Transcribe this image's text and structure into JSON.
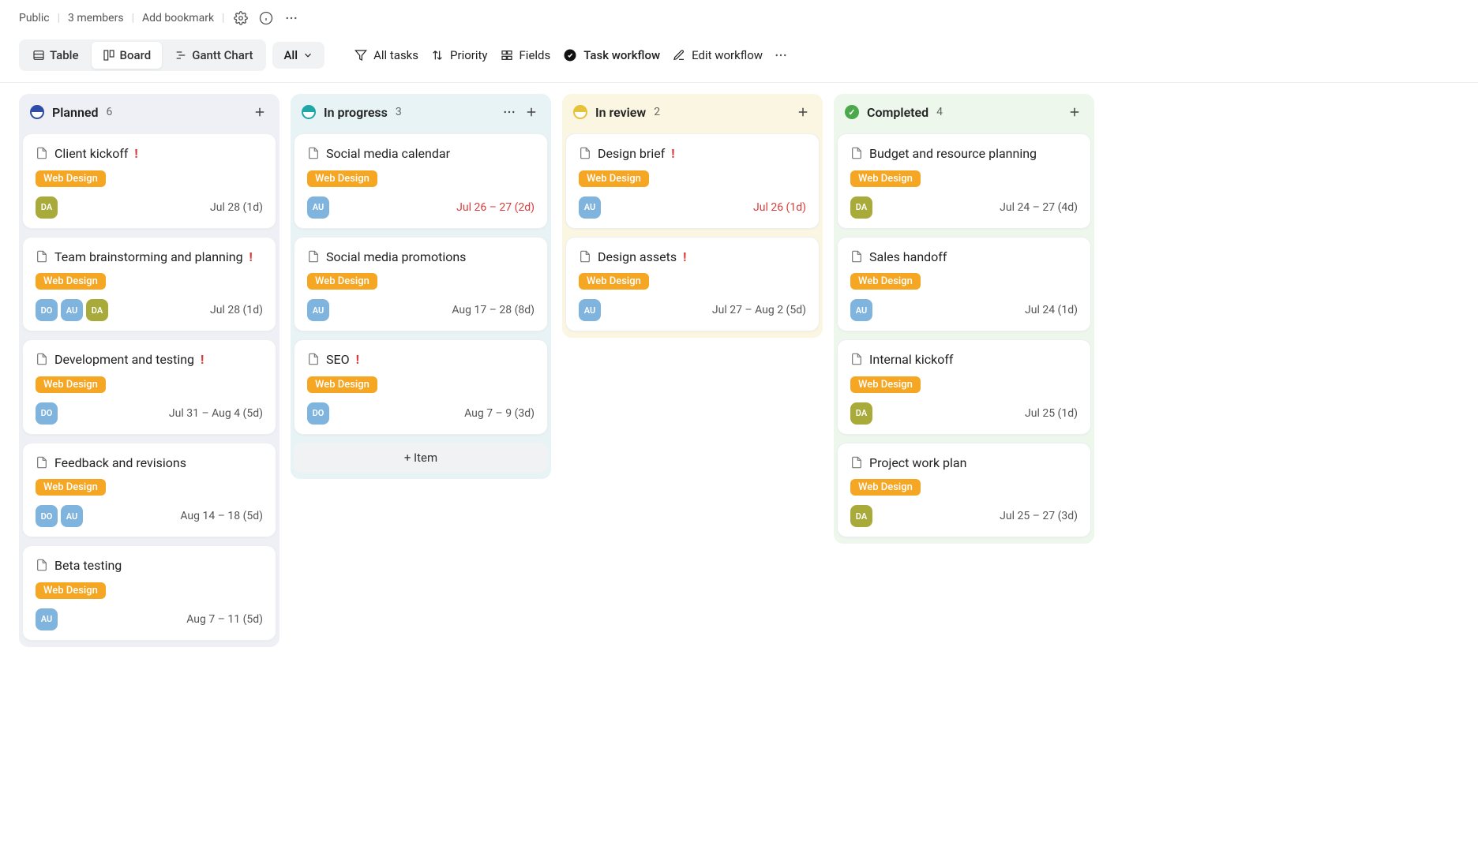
{
  "topbar": {
    "visibility": "Public",
    "members": "3 members",
    "add_bookmark": "Add bookmark"
  },
  "views": {
    "table": "Table",
    "board": "Board",
    "gantt": "Gantt Chart",
    "all": "All"
  },
  "toolbar": {
    "all_tasks": "All tasks",
    "priority": "Priority",
    "fields": "Fields",
    "task_workflow": "Task workflow",
    "edit_workflow": "Edit workflow"
  },
  "avatar_colors": {
    "DA": "av-olive",
    "AU": "av-blue",
    "DO": "av-blue"
  },
  "columns": [
    {
      "key": "planned",
      "title": "Planned",
      "count": 6,
      "tint": "col-planned",
      "status_icon": "dot-half-blue",
      "show_menu": false,
      "add_item": null,
      "cards": [
        {
          "title": "Client kickoff",
          "priority": true,
          "tag": "Web Design",
          "avatars": [
            "DA"
          ],
          "date": "Jul 28 (1d)",
          "overdue": false
        },
        {
          "title": "Team brainstorming and planning",
          "priority": true,
          "tag": "Web Design",
          "avatars": [
            "DO",
            "AU",
            "DA"
          ],
          "date": "Jul 28 (1d)",
          "overdue": false
        },
        {
          "title": "Development and testing",
          "priority": true,
          "tag": "Web Design",
          "avatars": [
            "DO"
          ],
          "date": "Jul 31 – Aug 4 (5d)",
          "overdue": false
        },
        {
          "title": "Feedback and revisions",
          "priority": false,
          "tag": "Web Design",
          "avatars": [
            "DO",
            "AU"
          ],
          "date": "Aug 14 – 18 (5d)",
          "overdue": false
        },
        {
          "title": "Beta testing",
          "priority": false,
          "tag": "Web Design",
          "avatars": [
            "AU"
          ],
          "date": "Aug 7 – 11 (5d)",
          "overdue": false
        }
      ]
    },
    {
      "key": "inprogress",
      "title": "In progress",
      "count": 3,
      "tint": "col-inprogress",
      "status_icon": "dot-half-teal",
      "show_menu": true,
      "add_item": "+ Item",
      "cards": [
        {
          "title": "Social media calendar",
          "priority": false,
          "tag": "Web Design",
          "avatars": [
            "AU"
          ],
          "date": "Jul 26 – 27 (2d)",
          "overdue": true
        },
        {
          "title": "Social media promotions",
          "priority": false,
          "tag": "Web Design",
          "avatars": [
            "AU"
          ],
          "date": "Aug 17 – 28 (8d)",
          "overdue": false
        },
        {
          "title": "SEO",
          "priority": true,
          "tag": "Web Design",
          "avatars": [
            "DO"
          ],
          "date": "Aug 7 – 9 (3d)",
          "overdue": false
        }
      ]
    },
    {
      "key": "review",
      "title": "In review",
      "count": 2,
      "tint": "col-review",
      "status_icon": "dot-half-yellow",
      "show_menu": false,
      "add_item": null,
      "cards": [
        {
          "title": "Design brief",
          "priority": true,
          "tag": "Web Design",
          "avatars": [
            "AU"
          ],
          "date": "Jul 26 (1d)",
          "overdue": true
        },
        {
          "title": "Design assets",
          "priority": true,
          "tag": "Web Design",
          "avatars": [
            "AU"
          ],
          "date": "Jul 27 – Aug 2 (5d)",
          "overdue": false
        }
      ]
    },
    {
      "key": "completed",
      "title": "Completed",
      "count": 4,
      "tint": "col-completed",
      "status_icon": "dot-check",
      "show_menu": false,
      "add_item": null,
      "cards": [
        {
          "title": "Budget and resource planning",
          "priority": false,
          "tag": "Web Design",
          "avatars": [
            "DA"
          ],
          "date": "Jul 24 – 27 (4d)",
          "overdue": false
        },
        {
          "title": "Sales handoff",
          "priority": false,
          "tag": "Web Design",
          "avatars": [
            "AU"
          ],
          "date": "Jul 24 (1d)",
          "overdue": false
        },
        {
          "title": "Internal kickoff",
          "priority": false,
          "tag": "Web Design",
          "avatars": [
            "DA"
          ],
          "date": "Jul 25 (1d)",
          "overdue": false
        },
        {
          "title": "Project work plan",
          "priority": false,
          "tag": "Web Design",
          "avatars": [
            "DA"
          ],
          "date": "Jul 25 – 27 (3d)",
          "overdue": false
        }
      ]
    }
  ]
}
